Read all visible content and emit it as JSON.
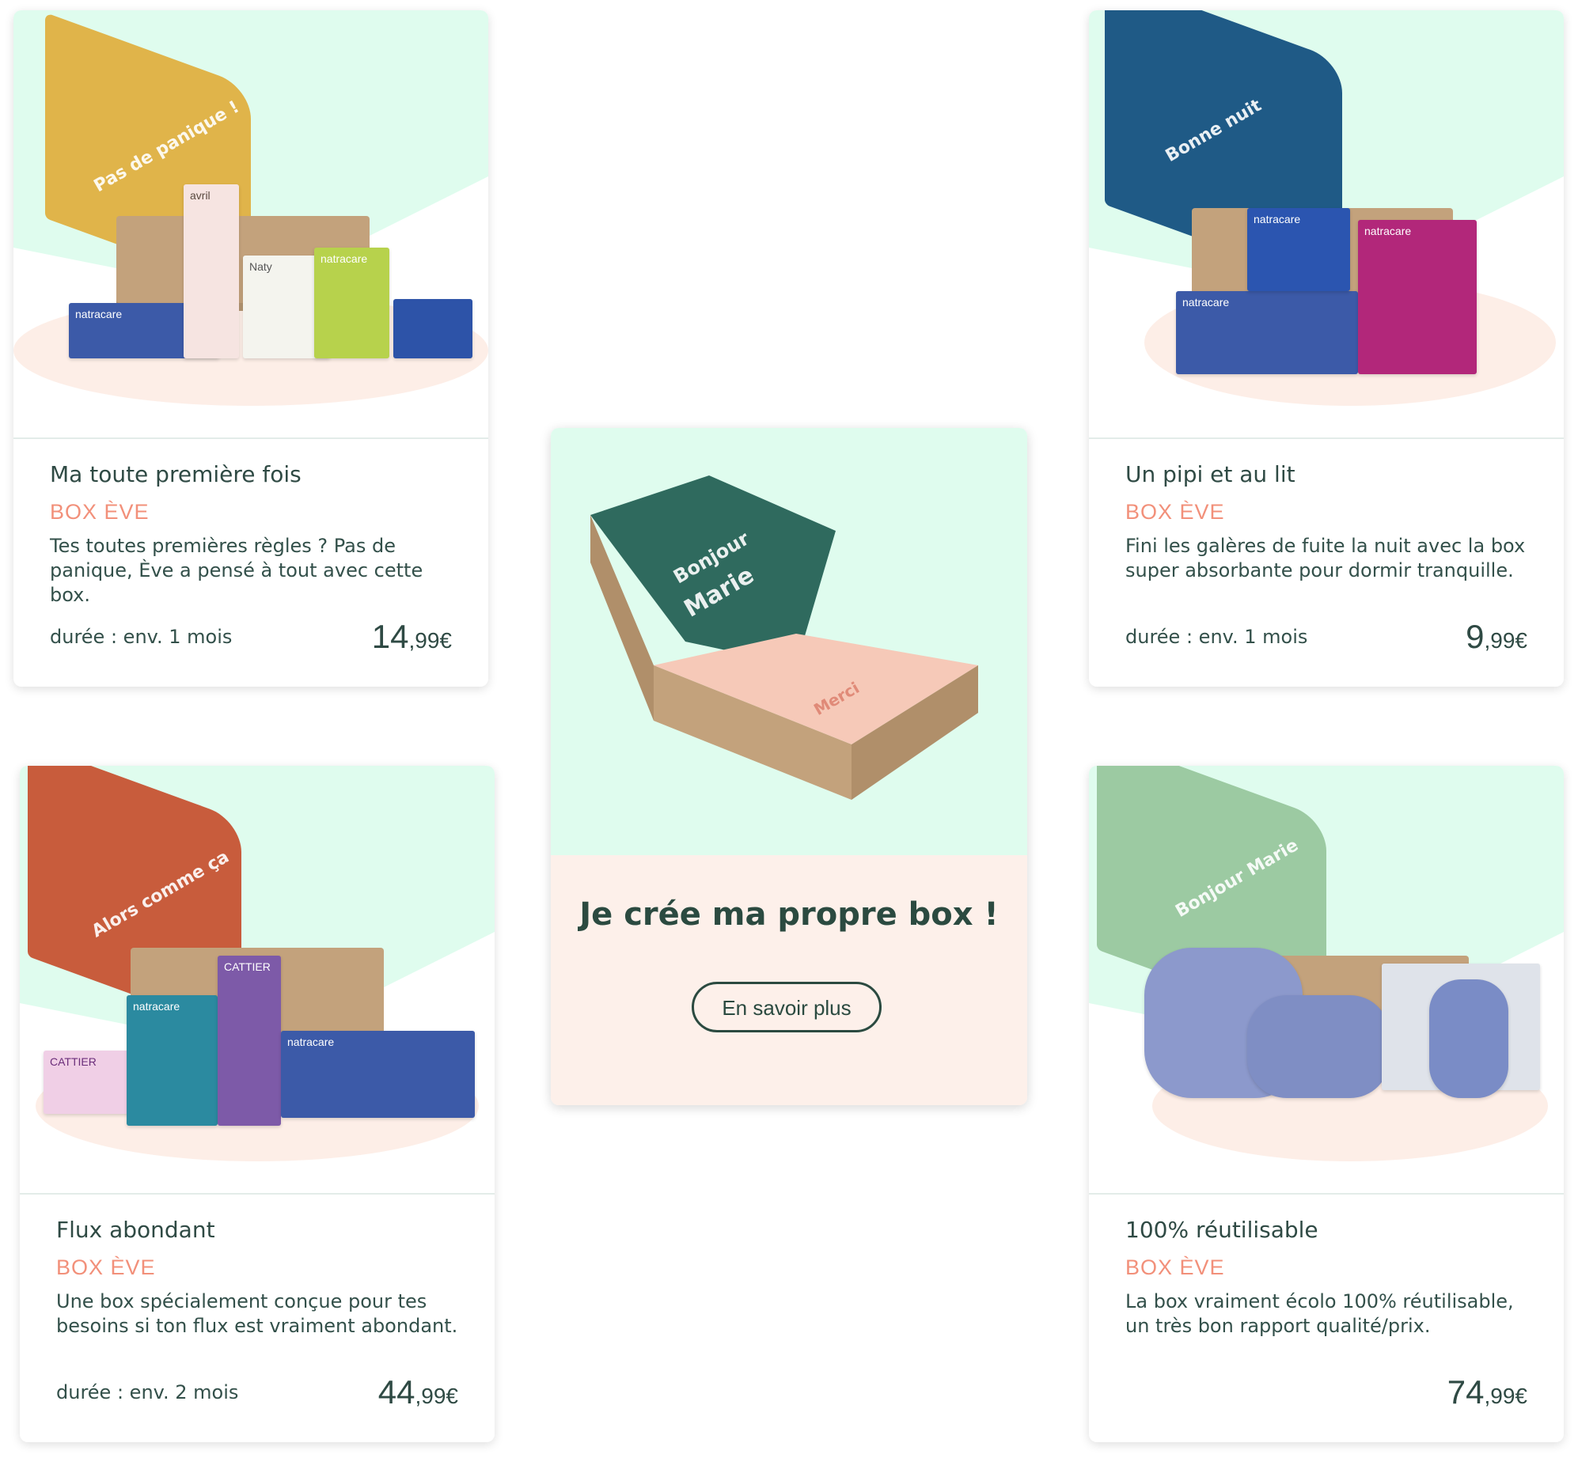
{
  "cards": [
    {
      "title": "Ma toute première fois",
      "brand": "BOX ÈVE",
      "description": "Tes toutes premières règles ? Pas de panique, Ève a pensé à tout avec cette box.",
      "duration_label": "durée :",
      "duration_value": "env. 1 mois",
      "price_main": "14",
      "price_cents": ",99€",
      "lid_text": "Pas de panique !",
      "lid_color": "#e0b44a",
      "product_labels": [
        "natracare",
        "avril",
        "Naty",
        "natracare"
      ]
    },
    {
      "title": "Un pipi et au lit",
      "brand": "BOX ÈVE",
      "description": "Fini les galères de fuite la nuit avec la box super absorbante pour dormir tranquille.",
      "duration_label": "durée :",
      "duration_value": "env. 1 mois",
      "price_main": "9",
      "price_cents": ",99€",
      "lid_text": "Bonne nuit",
      "lid_color": "#1f5a86",
      "product_labels": [
        "natracare",
        "natracare",
        "natracare"
      ]
    },
    {
      "title": "Flux abondant",
      "brand": "BOX ÈVE",
      "description": "Une box spécialement conçue pour tes besoins si ton flux est vraiment abondant.",
      "duration_label": "durée :",
      "duration_value": "env. 2 mois",
      "price_main": "44",
      "price_cents": ",99€",
      "lid_text": "Alors comme ça",
      "lid_color": "#c85c3c",
      "product_labels": [
        "natracare",
        "CATTIER",
        "natracare",
        "CATTIER"
      ]
    },
    {
      "title": "100% réutilisable",
      "brand": "BOX ÈVE",
      "description": "La box vraiment écolo 100% réutilisable, un très bon rapport qualité/prix.",
      "price_main": "74",
      "price_cents": ",99€",
      "lid_text": "Bonjour Marie",
      "lid_color": "#9ccaa2",
      "product_labels": []
    }
  ],
  "custom_box": {
    "title": "Je crée ma propre box !",
    "cta_label": "En savoir plus",
    "lid_line1": "Bonjour",
    "lid_line2": "Marie",
    "inner_text": "Merci",
    "lid_color": "#2f6a5e"
  },
  "colors": {
    "mint": "#dffcee",
    "peach": "#fdeee7",
    "accent": "#f2907a",
    "text": "#2b4844"
  }
}
